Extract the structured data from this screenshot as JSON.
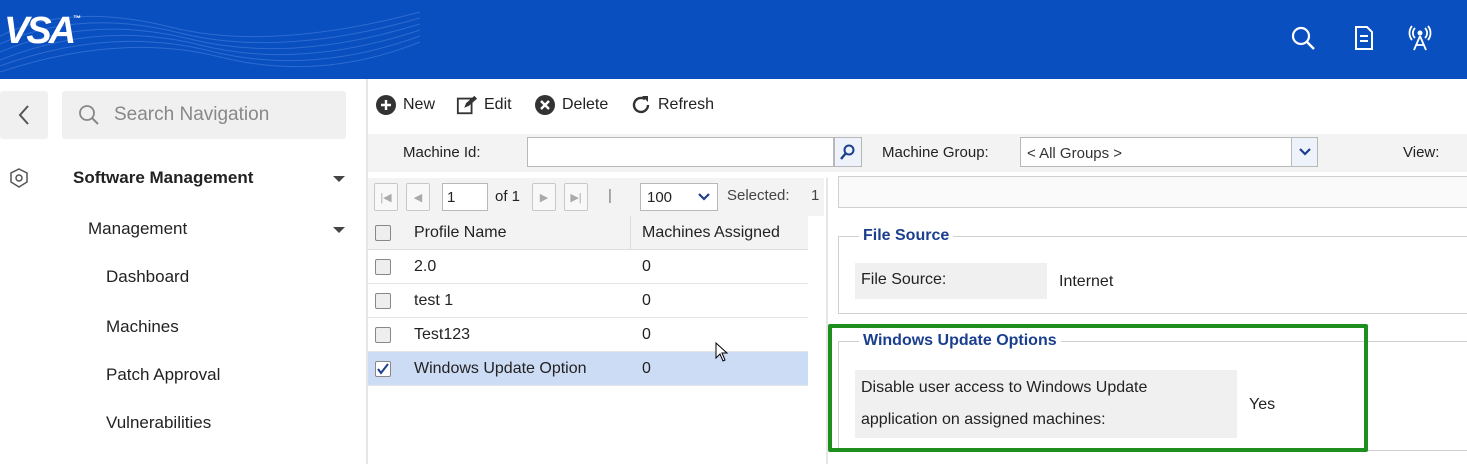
{
  "header": {
    "logo": "VSA",
    "logo_tm": "™",
    "icons": [
      "search-icon",
      "document-icon",
      "antenna-icon"
    ],
    "bg_color": "#0a4fbf"
  },
  "sidebar": {
    "search_placeholder": "Search Navigation",
    "section": "Software Management",
    "subsection": "Management",
    "items": [
      "Dashboard",
      "Machines",
      "Patch Approval",
      "Vulnerabilities"
    ]
  },
  "toolbar": {
    "new_label": "New",
    "edit_label": "Edit",
    "delete_label": "Delete",
    "refresh_label": "Refresh"
  },
  "filters": {
    "machine_id_label": "Machine Id:",
    "machine_id_value": "",
    "machine_group_label": "Machine Group:",
    "machine_group_value": "< All Groups >",
    "view_label": "View:"
  },
  "pager": {
    "page": "1",
    "of_label": "of 1",
    "separator": "|",
    "page_size": "100",
    "selected_label": "Selected:",
    "selected_count": "1"
  },
  "grid": {
    "columns": [
      "Profile Name",
      "Machines Assigned"
    ],
    "rows": [
      {
        "name": "2.0",
        "assigned": "0",
        "checked": false
      },
      {
        "name": "test 1",
        "assigned": "0",
        "checked": false
      },
      {
        "name": "Test123",
        "assigned": "0",
        "checked": false
      },
      {
        "name": "Windows Update Option",
        "assigned": "0",
        "checked": true
      }
    ]
  },
  "detail": {
    "file_source_legend": "File Source",
    "file_source_key": "File Source:",
    "file_source_value": "Internet",
    "wu_legend": "Windows Update Options",
    "wu_key_line1": "Disable user access to Windows Update",
    "wu_key_line2": "application on assigned machines:",
    "wu_value": "Yes"
  },
  "highlight_color": "#1e8f1e"
}
